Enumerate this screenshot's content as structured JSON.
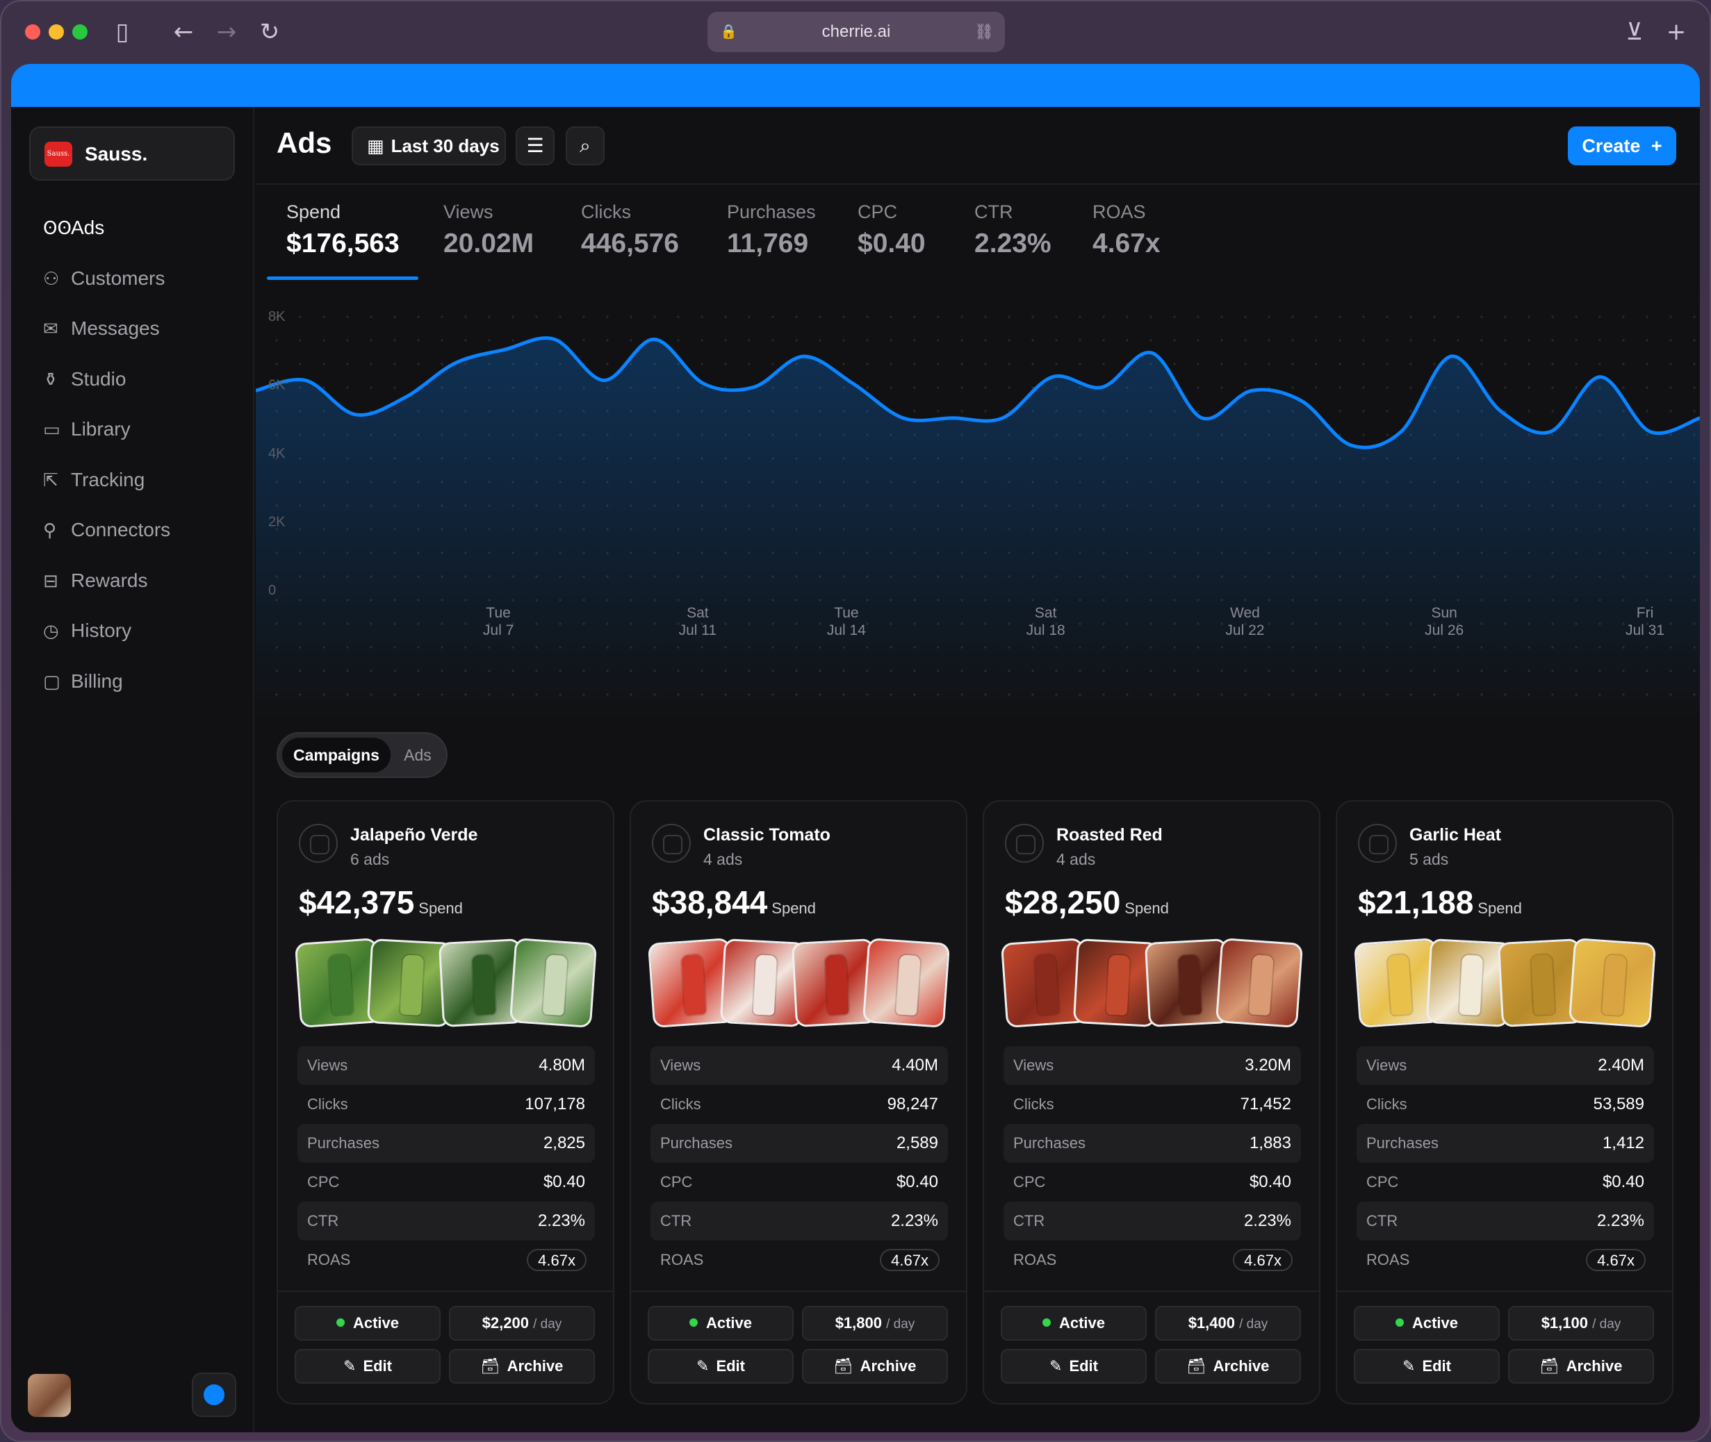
{
  "browser": {
    "url": "cherrie.ai"
  },
  "brand": {
    "name": "Sauss.",
    "logo_text": "Sauss."
  },
  "sidebar": {
    "items": [
      {
        "label": "Ads",
        "icon": "ads-icon",
        "glyph": "ʘʘ"
      },
      {
        "label": "Customers",
        "icon": "customers-icon",
        "glyph": "⚇"
      },
      {
        "label": "Messages",
        "icon": "mail-icon",
        "glyph": "✉"
      },
      {
        "label": "Studio",
        "icon": "studio-icon",
        "glyph": "⚱"
      },
      {
        "label": "Library",
        "icon": "video-icon",
        "glyph": "▭"
      },
      {
        "label": "Tracking",
        "icon": "cursor-icon",
        "glyph": "⇱"
      },
      {
        "label": "Connectors",
        "icon": "plug-icon",
        "glyph": "⚲"
      },
      {
        "label": "Rewards",
        "icon": "ticket-icon",
        "glyph": "⊟"
      },
      {
        "label": "History",
        "icon": "clock-icon",
        "glyph": "◷"
      },
      {
        "label": "Billing",
        "icon": "wallet-icon",
        "glyph": "▢"
      }
    ]
  },
  "header": {
    "title": "Ads",
    "date_range": "Last 30 days",
    "create_label": "Create",
    "create_glyph": "+"
  },
  "metrics": [
    {
      "label": "Spend",
      "value": "$176,563"
    },
    {
      "label": "Views",
      "value": "20.02M"
    },
    {
      "label": "Clicks",
      "value": "446,576"
    },
    {
      "label": "Purchases",
      "value": "11,769"
    },
    {
      "label": "CPC",
      "value": "$0.40"
    },
    {
      "label": "CTR",
      "value": "2.23%"
    },
    {
      "label": "ROAS",
      "value": "4.67x"
    }
  ],
  "chart_data": {
    "type": "area",
    "series": [
      {
        "values": [
          5800,
          6100,
          5100,
          5600,
          6600,
          7000,
          7300,
          6100,
          7300,
          6000,
          5900,
          6800,
          6000,
          5000,
          5000,
          5000,
          6200,
          5900,
          6900,
          5000,
          5800,
          5500,
          4200,
          4600,
          6800,
          5200,
          4600,
          6200,
          4600,
          5000
        ]
      }
    ],
    "y_ticks": [
      "8K",
      "6K",
      "4K",
      "2K",
      "0"
    ],
    "ylim": [
      0,
      8000
    ],
    "x_ticks": [
      {
        "day": "Tue",
        "date": "Jul 7"
      },
      {
        "day": "Sat",
        "date": "Jul 11"
      },
      {
        "day": "Tue",
        "date": "Jul 14"
      },
      {
        "day": "Sat",
        "date": "Jul 18"
      },
      {
        "day": "Wed",
        "date": "Jul 22"
      },
      {
        "day": "Sun",
        "date": "Jul 26"
      },
      {
        "day": "Fri",
        "date": "Jul 31"
      }
    ],
    "color": "#0a84ff",
    "grid": "dotted"
  },
  "tabs": {
    "campaigns": "Campaigns",
    "ads": "Ads"
  },
  "campaigns": [
    {
      "name": "Jalapeño Verde",
      "ads": "6 ads",
      "spend": "$42,375",
      "spend_label": "Spend",
      "views": "4.80M",
      "clicks": "107,178",
      "purchases": "2,825",
      "cpc": "$0.40",
      "ctr": "2.23%",
      "roas": "4.67x",
      "status": "Active",
      "budget": "$2,200",
      "budget_unit": "/ day",
      "theme": [
        "#3f7a2e",
        "#8ab34f",
        "#2d5a22",
        "#c9d8b6"
      ]
    },
    {
      "name": "Classic Tomato",
      "ads": "4 ads",
      "spend": "$38,844",
      "spend_label": "Spend",
      "views": "4.40M",
      "clicks": "98,247",
      "purchases": "2,589",
      "cpc": "$0.40",
      "ctr": "2.23%",
      "roas": "4.67x",
      "status": "Active",
      "budget": "$1,800",
      "budget_unit": "/ day",
      "theme": [
        "#d33a2c",
        "#f1e6df",
        "#b92a1f",
        "#e9d2c4"
      ]
    },
    {
      "name": "Roasted Red",
      "ads": "4 ads",
      "spend": "$28,250",
      "spend_label": "Spend",
      "views": "3.20M",
      "clicks": "71,452",
      "purchases": "1,883",
      "cpc": "$0.40",
      "ctr": "2.23%",
      "roas": "4.67x",
      "status": "Active",
      "budget": "$1,400",
      "budget_unit": "/ day",
      "theme": [
        "#8a2a1c",
        "#c44a2e",
        "#5b2318",
        "#d99a74"
      ]
    },
    {
      "name": "Garlic Heat",
      "ads": "5 ads",
      "spend": "$21,188",
      "spend_label": "Spend",
      "views": "2.40M",
      "clicks": "53,589",
      "purchases": "1,412",
      "cpc": "$0.40",
      "ctr": "2.23%",
      "roas": "4.67x",
      "status": "Active",
      "budget": "$1,100",
      "budget_unit": "/ day",
      "theme": [
        "#e9c04a",
        "#f2ead9",
        "#b78a2a",
        "#d9a441"
      ]
    }
  ],
  "stat_labels": {
    "views": "Views",
    "clicks": "Clicks",
    "purchases": "Purchases",
    "cpc": "CPC",
    "ctr": "CTR",
    "roas": "ROAS"
  },
  "actions": {
    "edit": "Edit",
    "archive": "Archive"
  }
}
